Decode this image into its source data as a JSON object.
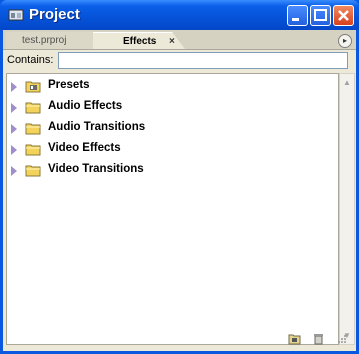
{
  "window": {
    "title": "Project"
  },
  "tabs": [
    {
      "label": "test.prproj"
    },
    {
      "label": "Effects",
      "close": "×"
    }
  ],
  "search": {
    "label": "Contains:",
    "value": ""
  },
  "tree": [
    {
      "label": "Presets",
      "icon": "preset-folder-icon"
    },
    {
      "label": "Audio Effects",
      "icon": "folder-icon"
    },
    {
      "label": "Audio Transitions",
      "icon": "folder-icon"
    },
    {
      "label": "Video Effects",
      "icon": "folder-icon"
    },
    {
      "label": "Video Transitions",
      "icon": "folder-icon"
    }
  ],
  "colors": {
    "titlebar": "#0552d8",
    "panel": "#ece9d8",
    "arrow": "#a08ecb",
    "folder": "#f3d35a"
  }
}
